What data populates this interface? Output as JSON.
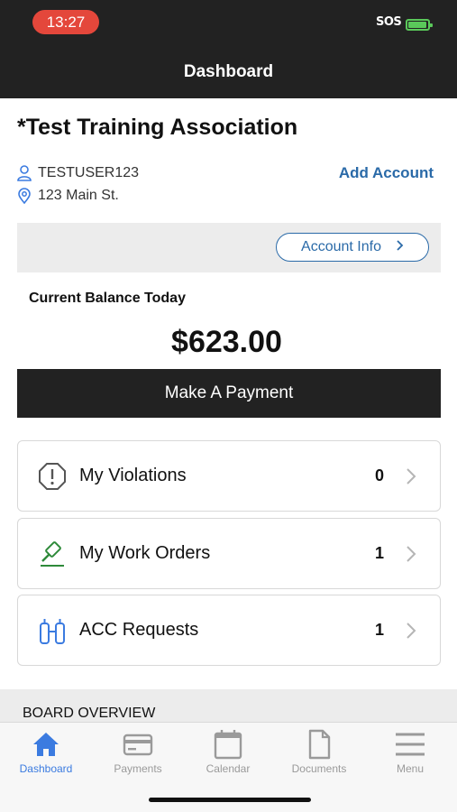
{
  "status_bar": {
    "time": "13:27",
    "sos": "SOS"
  },
  "nav": {
    "title": "Dashboard"
  },
  "association": {
    "name": "*Test Training Association",
    "user": "TESTUSER123",
    "address": "123 Main St.",
    "add_account_label": "Add Account",
    "account_info_label": "Account Info"
  },
  "balance": {
    "label": "Current Balance Today",
    "amount": "$623.00",
    "pay_button": "Make A Payment"
  },
  "cards": [
    {
      "label": "My Violations",
      "count": "0",
      "icon": "alert-octagon-icon"
    },
    {
      "label": "My Work Orders",
      "count": "1",
      "icon": "hammer-icon"
    },
    {
      "label": "ACC Requests",
      "count": "1",
      "icon": "acc-request-icon"
    }
  ],
  "board": {
    "label": "BOARD OVERVIEW"
  },
  "tabs": [
    {
      "label": "Dashboard",
      "icon": "home-icon",
      "active": true
    },
    {
      "label": "Payments",
      "icon": "credit-card-icon",
      "active": false
    },
    {
      "label": "Calendar",
      "icon": "calendar-icon",
      "active": false
    },
    {
      "label": "Documents",
      "icon": "document-icon",
      "active": false
    },
    {
      "label": "Menu",
      "icon": "hamburger-menu-icon",
      "active": false
    }
  ],
  "colors": {
    "header": "#222222",
    "accent": "#2a6aa8",
    "tab_active": "#3b7be0",
    "work_order_icon": "#2e8a3a",
    "time_pill": "#e4473b"
  }
}
